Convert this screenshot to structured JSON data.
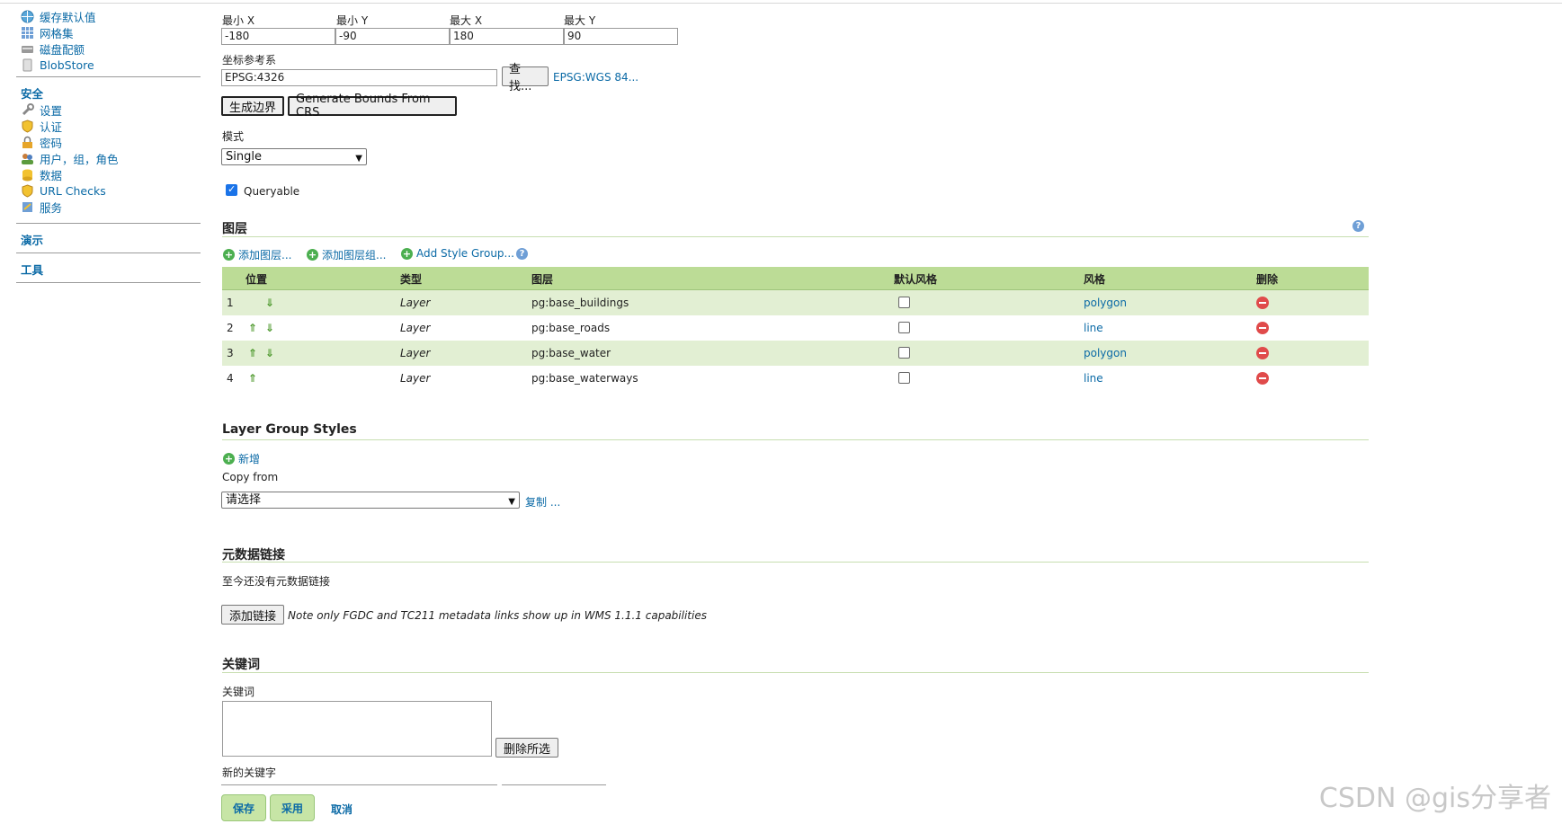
{
  "sidebar": {
    "items_top": [
      {
        "label": "缓存默认值",
        "icon": "globe-icon"
      },
      {
        "label": "网格集",
        "icon": "grid-icon"
      },
      {
        "label": "磁盘配额",
        "icon": "disk-icon"
      },
      {
        "label": "BlobStore",
        "icon": "blob-icon"
      }
    ],
    "security_heading": "安全",
    "security_items": [
      {
        "label": "设置",
        "icon": "wrench-icon"
      },
      {
        "label": "认证",
        "icon": "shield-icon"
      },
      {
        "label": "密码",
        "icon": "lock-icon"
      },
      {
        "label": "用户，组，角色",
        "icon": "users-icon"
      },
      {
        "label": "数据",
        "icon": "data-icon"
      },
      {
        "label": "URL Checks",
        "icon": "shield-icon"
      },
      {
        "label": "服务",
        "icon": "service-icon"
      }
    ],
    "demo_heading": "演示",
    "tools_heading": "工具"
  },
  "bounds": {
    "minx_label": "最小 X",
    "miny_label": "最小 Y",
    "maxx_label": "最大 X",
    "maxy_label": "最大 Y",
    "minx": "-180",
    "miny": "-90",
    "maxx": "180",
    "maxy": "90"
  },
  "crs": {
    "label": "坐标参考系",
    "value": "EPSG:4326",
    "find_button": "查找...",
    "link": "EPSG:WGS 84..."
  },
  "bounds_buttons": {
    "generate": "生成边界",
    "from_crs": "Generate Bounds From CRS"
  },
  "mode": {
    "label": "模式",
    "value": "Single"
  },
  "queryable": {
    "label": "Queryable",
    "checked": true
  },
  "layers": {
    "title": "图层",
    "add_layer": "添加图层...",
    "add_group": "添加图层组...",
    "add_style_group": "Add Style Group...",
    "columns": [
      "位置",
      "类型",
      "图层",
      "默认风格",
      "风格",
      "删除"
    ],
    "rows": [
      {
        "pos": "1",
        "type": "Layer",
        "layer": "pg:base_buildings",
        "style": "polygon"
      },
      {
        "pos": "2",
        "type": "Layer",
        "layer": "pg:base_roads",
        "style": "line"
      },
      {
        "pos": "3",
        "type": "Layer",
        "layer": "pg:base_water",
        "style": "polygon"
      },
      {
        "pos": "4",
        "type": "Layer",
        "layer": "pg:base_waterways",
        "style": "line"
      }
    ]
  },
  "lgs": {
    "title": "Layer Group Styles",
    "new": "新增",
    "copy_from": "Copy from",
    "select_placeholder": "请选择",
    "copy": "复制 ..."
  },
  "metadata": {
    "title": "元数据链接",
    "empty": "至今还没有元数据链接",
    "add_link": "添加链接",
    "note": "Note only FGDC and TC211 metadata links show up in WMS 1.1.1 capabilities"
  },
  "keywords": {
    "title": "关键词",
    "label": "关键词",
    "remove": "删除所选",
    "new_label": "新的关键字"
  },
  "footer": {
    "save": "保存",
    "apply": "采用",
    "cancel": "取消"
  },
  "watermark": "CSDN @gis分享者",
  "colors": {
    "accent": "#0b6aa6",
    "table_header": "#bcdc96",
    "row_odd": "#e2efd3",
    "section_line": "#c7deb0"
  }
}
